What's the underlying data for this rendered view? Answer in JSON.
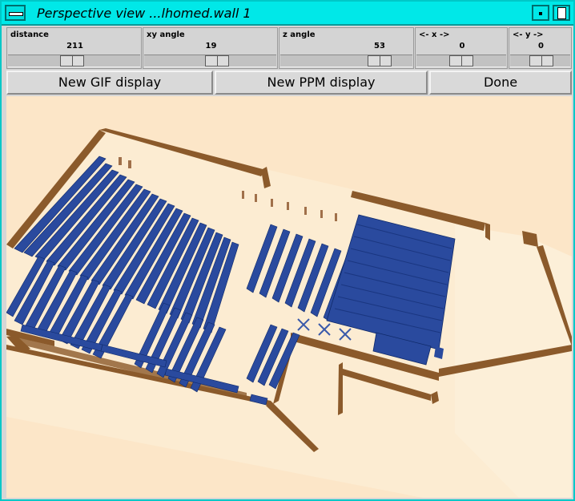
{
  "window": {
    "title": "Perspective view ...lhomed.wall 1"
  },
  "sliders": [
    {
      "label": "distance",
      "value": "211"
    },
    {
      "label": "xy angle",
      "value": "19"
    },
    {
      "label": "z angle",
      "value": "53"
    },
    {
      "label": "<- x ->",
      "value": "0"
    },
    {
      "label": "<- y ->",
      "value": "0"
    }
  ],
  "buttons": {
    "new_gif": "New GIF display",
    "new_ppm": "New PPM display",
    "done": "Done"
  },
  "colors": {
    "floor": "#fce6c8",
    "wall": "#8b5a2b",
    "shelf": "#2a4a9e",
    "window_bg": "#00e8e8"
  }
}
